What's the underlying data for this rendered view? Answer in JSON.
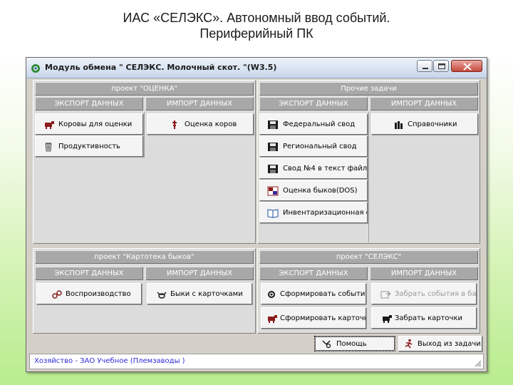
{
  "slide": {
    "title_line1": "ИАС «СЕЛЭКС». Автономный ввод событий.",
    "title_line2": "Периферийный ПК"
  },
  "window": {
    "title": "Модуль обмена \" СЕЛЭКС. Молочный скот. \"(W3.5)"
  },
  "project_ocenka": {
    "header": "проект \"ОЦЕНКА\"",
    "export": {
      "header": "ЭКСПОРТ ДАННЫХ",
      "buttons": [
        "Коровы для оценки",
        "Продуктивность"
      ]
    },
    "import": {
      "header": "ИМПОРТ ДАННЫХ",
      "buttons": [
        "Оценка коров"
      ]
    }
  },
  "other_tasks": {
    "header": "Прочие задачи",
    "export": {
      "header": "ЭКСПОРТ ДАННЫХ",
      "buttons": [
        "Федеральный свод",
        "Региональный свод",
        "Свод №4 в текст файл",
        "Оценка быков(DOS)",
        "Инвентаризационная опись"
      ]
    },
    "import": {
      "header": "ИМПОРТ ДАННЫХ",
      "buttons": [
        "Справочники"
      ]
    }
  },
  "project_kartoteka": {
    "header": "проект \"Картотека быков\"",
    "export": {
      "header": "ЭКСПОРТ ДАННЫХ",
      "buttons": [
        "Воспроизводство"
      ]
    },
    "import": {
      "header": "ИМПОРТ ДАННЫХ",
      "buttons": [
        "Быки с карточками"
      ]
    }
  },
  "project_seleks": {
    "header": "проект \"СЕЛЭКС\"",
    "export": {
      "header": "ЭКСПОРТ ДАННЫХ",
      "buttons": [
        "Сформировать события",
        "Сформировать карточки"
      ]
    },
    "import": {
      "header": "ИМПОРТ ДАННЫХ",
      "buttons": [
        "Забрать события в базу",
        "Забрать карточки"
      ]
    }
  },
  "footer": {
    "help": "Помощь",
    "exit": "Выход из задачи"
  },
  "status": {
    "text": "Хозяйство - ЗАО Учебное (Племзаводы )"
  },
  "colors": {
    "status_text": "#2a2adc",
    "header_bg": "#a8a8a8"
  }
}
